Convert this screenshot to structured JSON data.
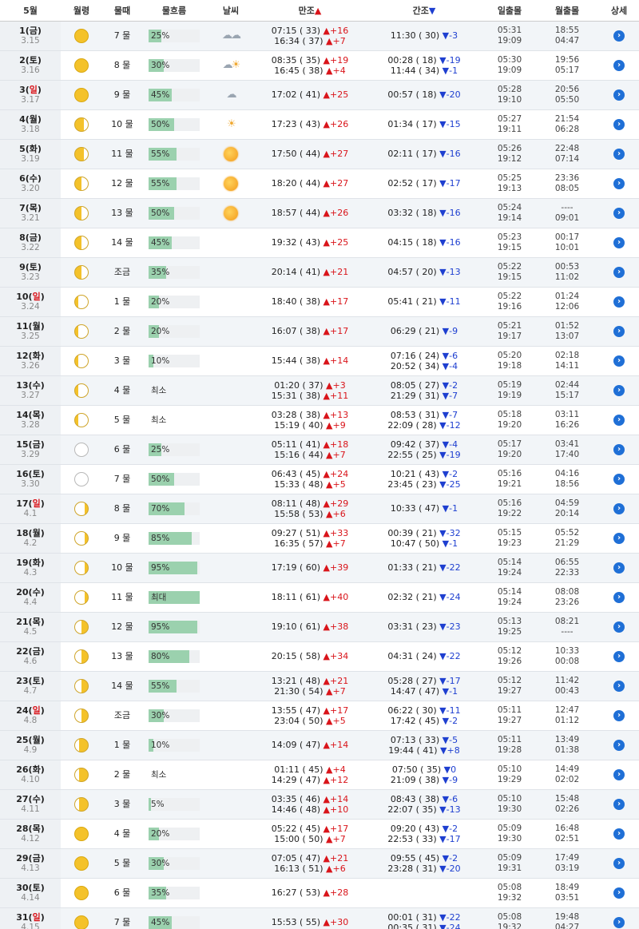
{
  "headers": {
    "date": "5월",
    "moon": "월령",
    "tide_age": "물때",
    "flow": "물흐름",
    "weather": "날씨",
    "high": "만조",
    "low": "간조",
    "sun": "일출몰",
    "moonrise": "월출몰",
    "detail": "상세"
  },
  "symbols": {
    "up": "▲",
    "down": "▼",
    "detail": "›"
  },
  "rows": [
    {
      "day": "1(",
      "dow": "금",
      "end": ")",
      "lunar": "3.15",
      "moon": "full",
      "age": "7 물",
      "flow": "25%",
      "pct": 25,
      "weather": [
        "rain-cloud-icon",
        "rain-cloud-icon"
      ],
      "high": [
        [
          "07:15 ( 33)",
          "+16"
        ],
        [
          "16:34 ( 37)",
          "+7"
        ]
      ],
      "low": [
        [
          "11:30 ( 30)",
          "-3"
        ]
      ],
      "sun": [
        "05:31",
        "19:09"
      ],
      "mn": [
        "18:55",
        "04:47"
      ]
    },
    {
      "day": "2(",
      "dow": "토",
      "end": ")",
      "lunar": "3.16",
      "moon": "full",
      "age": "8 물",
      "flow": "30%",
      "pct": 30,
      "weather": [
        "cloud-icon",
        "sun-cloud-icon"
      ],
      "high": [
        [
          "08:35 ( 35)",
          "+19"
        ],
        [
          "16:45 ( 38)",
          "+4"
        ]
      ],
      "low": [
        [
          "00:28 ( 18)",
          "-19"
        ],
        [
          "11:44 ( 34)",
          "-1"
        ]
      ],
      "sun": [
        "05:30",
        "19:09"
      ],
      "mn": [
        "19:56",
        "05:17"
      ]
    },
    {
      "day": "3(",
      "dow": "일",
      "end": ")",
      "lunar": "3.17",
      "moon": "full",
      "age": "9 물",
      "flow": "45%",
      "pct": 45,
      "weather": [
        "rain-cloud-icon"
      ],
      "high": [
        [
          "17:02 ( 41)",
          "+25"
        ]
      ],
      "low": [
        [
          "00:57 ( 18)",
          "-20"
        ]
      ],
      "sun": [
        "05:28",
        "19:10"
      ],
      "mn": [
        "20:56",
        "05:50"
      ]
    },
    {
      "day": "4(",
      "dow": "월",
      "end": ")",
      "lunar": "3.18",
      "moon": "wane-r",
      "age": "10 물",
      "flow": "50%",
      "pct": 50,
      "weather": [
        "sun-cloud-icon"
      ],
      "high": [
        [
          "17:23 ( 43)",
          "+26"
        ]
      ],
      "low": [
        [
          "01:34 ( 17)",
          "-15"
        ]
      ],
      "sun": [
        "05:27",
        "19:11"
      ],
      "mn": [
        "21:54",
        "06:28"
      ]
    },
    {
      "day": "5(",
      "dow": "화",
      "end": ")",
      "lunar": "3.19",
      "moon": "wane-r",
      "age": "11 물",
      "flow": "55%",
      "pct": 55,
      "weather": [
        "sun-icon"
      ],
      "high": [
        [
          "17:50 ( 44)",
          "+27"
        ]
      ],
      "low": [
        [
          "02:11 ( 17)",
          "-16"
        ]
      ],
      "sun": [
        "05:26",
        "19:12"
      ],
      "mn": [
        "22:48",
        "07:14"
      ]
    },
    {
      "day": "6(",
      "dow": "수",
      "end": ")",
      "lunar": "3.20",
      "moon": "wane-h",
      "age": "12 물",
      "flow": "55%",
      "pct": 55,
      "weather": [
        "sun-icon"
      ],
      "high": [
        [
          "18:20 ( 44)",
          "+27"
        ]
      ],
      "low": [
        [
          "02:52 ( 17)",
          "-17"
        ]
      ],
      "sun": [
        "05:25",
        "19:13"
      ],
      "mn": [
        "23:36",
        "08:05"
      ]
    },
    {
      "day": "7(",
      "dow": "목",
      "end": ")",
      "lunar": "3.21",
      "moon": "wane-h",
      "age": "13 물",
      "flow": "50%",
      "pct": 50,
      "weather": [
        "sun-icon"
      ],
      "high": [
        [
          "18:57 ( 44)",
          "+26"
        ]
      ],
      "low": [
        [
          "03:32 ( 18)",
          "-16"
        ]
      ],
      "sun": [
        "05:24",
        "19:14"
      ],
      "mn": [
        "----",
        "09:01"
      ]
    },
    {
      "day": "8(",
      "dow": "금",
      "end": ")",
      "lunar": "3.22",
      "moon": "wane-h",
      "age": "14 물",
      "flow": "45%",
      "pct": 45,
      "weather": [],
      "high": [
        [
          "19:32 ( 43)",
          "+25"
        ]
      ],
      "low": [
        [
          "04:15 ( 18)",
          "-16"
        ]
      ],
      "sun": [
        "05:23",
        "19:15"
      ],
      "mn": [
        "00:17",
        "10:01"
      ]
    },
    {
      "day": "9(",
      "dow": "토",
      "end": ")",
      "lunar": "3.23",
      "moon": "wane-h",
      "age": "조금",
      "flow": "35%",
      "pct": 35,
      "weather": [],
      "high": [
        [
          "20:14 ( 41)",
          "+21"
        ]
      ],
      "low": [
        [
          "04:57 ( 20)",
          "-13"
        ]
      ],
      "sun": [
        "05:22",
        "19:15"
      ],
      "mn": [
        "00:53",
        "11:02"
      ]
    },
    {
      "day": "10(",
      "dow": "일",
      "end": ")",
      "lunar": "3.24",
      "moon": "wane-c",
      "age": "1 물",
      "flow": "20%",
      "pct": 20,
      "weather": [],
      "high": [
        [
          "18:40 ( 38)",
          "+17"
        ]
      ],
      "low": [
        [
          "05:41 ( 21)",
          "-11"
        ]
      ],
      "sun": [
        "05:22",
        "19:16"
      ],
      "mn": [
        "01:24",
        "12:06"
      ]
    },
    {
      "day": "11(",
      "dow": "월",
      "end": ")",
      "lunar": "3.25",
      "moon": "wane-c",
      "age": "2 물",
      "flow": "20%",
      "pct": 20,
      "weather": [],
      "high": [
        [
          "16:07 ( 38)",
          "+17"
        ]
      ],
      "low": [
        [
          "06:29 ( 21)",
          "-9"
        ]
      ],
      "sun": [
        "05:21",
        "19:17"
      ],
      "mn": [
        "01:52",
        "13:07"
      ]
    },
    {
      "day": "12(",
      "dow": "화",
      "end": ")",
      "lunar": "3.26",
      "moon": "wane-c",
      "age": "3 물",
      "flow": "10%",
      "pct": 10,
      "weather": [],
      "high": [
        [
          "15:44 ( 38)",
          "+14"
        ]
      ],
      "low": [
        [
          "07:16 ( 24)",
          "-6"
        ],
        [
          "20:52 ( 34)",
          "-4"
        ]
      ],
      "sun": [
        "05:20",
        "19:18"
      ],
      "mn": [
        "02:18",
        "14:11"
      ]
    },
    {
      "day": "13(",
      "dow": "수",
      "end": ")",
      "lunar": "3.27",
      "moon": "wane-c",
      "age": "4 물",
      "flow": "최소",
      "pct": 0,
      "weather": [],
      "high": [
        [
          "01:20 ( 37)",
          "+3"
        ],
        [
          "15:31 ( 38)",
          "+11"
        ]
      ],
      "low": [
        [
          "08:05 ( 27)",
          "-2"
        ],
        [
          "21:29 ( 31)",
          "-7"
        ]
      ],
      "sun": [
        "05:19",
        "19:19"
      ],
      "mn": [
        "02:44",
        "15:17"
      ]
    },
    {
      "day": "14(",
      "dow": "목",
      "end": ")",
      "lunar": "3.28",
      "moon": "wane-c",
      "age": "5 물",
      "flow": "최소",
      "pct": 0,
      "weather": [],
      "high": [
        [
          "03:28 ( 38)",
          "+13"
        ],
        [
          "15:19 ( 40)",
          "+9"
        ]
      ],
      "low": [
        [
          "08:53 ( 31)",
          "-7"
        ],
        [
          "22:09 ( 28)",
          "-12"
        ]
      ],
      "sun": [
        "05:18",
        "19:20"
      ],
      "mn": [
        "03:11",
        "16:26"
      ]
    },
    {
      "day": "15(",
      "dow": "금",
      "end": ")",
      "lunar": "3.29",
      "moon": "new",
      "age": "6 물",
      "flow": "25%",
      "pct": 25,
      "weather": [],
      "high": [
        [
          "05:11 ( 41)",
          "+18"
        ],
        [
          "15:16 ( 44)",
          "+7"
        ]
      ],
      "low": [
        [
          "09:42 ( 37)",
          "-4"
        ],
        [
          "22:55 ( 25)",
          "-19"
        ]
      ],
      "sun": [
        "05:17",
        "19:20"
      ],
      "mn": [
        "03:41",
        "17:40"
      ]
    },
    {
      "day": "16(",
      "dow": "토",
      "end": ")",
      "lunar": "3.30",
      "moon": "new",
      "age": "7 물",
      "flow": "50%",
      "pct": 50,
      "weather": [],
      "high": [
        [
          "06:43 ( 45)",
          "+24"
        ],
        [
          "15:33 ( 48)",
          "+5"
        ]
      ],
      "low": [
        [
          "10:21 ( 43)",
          "-2"
        ],
        [
          "23:45 ( 23)",
          "-25"
        ]
      ],
      "sun": [
        "05:16",
        "19:21"
      ],
      "mn": [
        "04:16",
        "18:56"
      ]
    },
    {
      "day": "17(",
      "dow": "일",
      "end": ")",
      "lunar": "4.1",
      "moon": "wax-c",
      "age": "8 물",
      "flow": "70%",
      "pct": 70,
      "weather": [],
      "high": [
        [
          "08:11 ( 48)",
          "+29"
        ],
        [
          "15:58 ( 53)",
          "+6"
        ]
      ],
      "low": [
        [
          "10:33 ( 47)",
          "-1"
        ]
      ],
      "sun": [
        "05:16",
        "19:22"
      ],
      "mn": [
        "04:59",
        "20:14"
      ]
    },
    {
      "day": "18(",
      "dow": "월",
      "end": ")",
      "lunar": "4.2",
      "moon": "wax-c",
      "age": "9 물",
      "flow": "85%",
      "pct": 85,
      "weather": [],
      "high": [
        [
          "09:27 ( 51)",
          "+33"
        ],
        [
          "16:35 ( 57)",
          "+7"
        ]
      ],
      "low": [
        [
          "00:39 ( 21)",
          "-32"
        ],
        [
          "10:47 ( 50)",
          "-1"
        ]
      ],
      "sun": [
        "05:15",
        "19:23"
      ],
      "mn": [
        "05:52",
        "21:29"
      ]
    },
    {
      "day": "19(",
      "dow": "화",
      "end": ")",
      "lunar": "4.3",
      "moon": "wax-c",
      "age": "10 물",
      "flow": "95%",
      "pct": 95,
      "weather": [],
      "high": [
        [
          "17:19 ( 60)",
          "+39"
        ]
      ],
      "low": [
        [
          "01:33 ( 21)",
          "-22"
        ]
      ],
      "sun": [
        "05:14",
        "19:24"
      ],
      "mn": [
        "06:55",
        "22:33"
      ]
    },
    {
      "day": "20(",
      "dow": "수",
      "end": ")",
      "lunar": "4.4",
      "moon": "wax-c",
      "age": "11 물",
      "flow": "최대",
      "pct": 100,
      "weather": [],
      "high": [
        [
          "18:11 ( 61)",
          "+40"
        ]
      ],
      "low": [
        [
          "02:32 ( 21)",
          "-24"
        ]
      ],
      "sun": [
        "05:14",
        "19:24"
      ],
      "mn": [
        "08:08",
        "23:26"
      ]
    },
    {
      "day": "21(",
      "dow": "목",
      "end": ")",
      "lunar": "4.5",
      "moon": "wax-h",
      "age": "12 물",
      "flow": "95%",
      "pct": 95,
      "weather": [],
      "high": [
        [
          "19:10 ( 61)",
          "+38"
        ]
      ],
      "low": [
        [
          "03:31 ( 23)",
          "-23"
        ]
      ],
      "sun": [
        "05:13",
        "19:25"
      ],
      "mn": [
        "08:21",
        "----"
      ]
    },
    {
      "day": "22(",
      "dow": "금",
      "end": ")",
      "lunar": "4.6",
      "moon": "wax-h",
      "age": "13 물",
      "flow": "80%",
      "pct": 80,
      "weather": [],
      "high": [
        [
          "20:15 ( 58)",
          "+34"
        ]
      ],
      "low": [
        [
          "04:31 ( 24)",
          "-22"
        ]
      ],
      "sun": [
        "05:12",
        "19:26"
      ],
      "mn": [
        "10:33",
        "00:08"
      ]
    },
    {
      "day": "23(",
      "dow": "토",
      "end": ")",
      "lunar": "4.7",
      "moon": "wax-h",
      "age": "14 물",
      "flow": "55%",
      "pct": 55,
      "weather": [],
      "high": [
        [
          "13:21 ( 48)",
          "+21"
        ],
        [
          "21:30 ( 54)",
          "+7"
        ]
      ],
      "low": [
        [
          "05:28 ( 27)",
          "-17"
        ],
        [
          "14:47 ( 47)",
          "-1"
        ]
      ],
      "sun": [
        "05:12",
        "19:27"
      ],
      "mn": [
        "11:42",
        "00:43"
      ]
    },
    {
      "day": "24(",
      "dow": "일",
      "end": ")",
      "lunar": "4.8",
      "moon": "wax-h",
      "age": "조금",
      "flow": "30%",
      "pct": 30,
      "weather": [],
      "high": [
        [
          "13:55 ( 47)",
          "+17"
        ],
        [
          "23:04 ( 50)",
          "+5"
        ]
      ],
      "low": [
        [
          "06:22 ( 30)",
          "-11"
        ],
        [
          "17:42 ( 45)",
          "-2"
        ]
      ],
      "sun": [
        "05:11",
        "19:27"
      ],
      "mn": [
        "12:47",
        "01:12"
      ]
    },
    {
      "day": "25(",
      "dow": "월",
      "end": ")",
      "lunar": "4.9",
      "moon": "wax-g",
      "age": "1 물",
      "flow": "10%",
      "pct": 10,
      "weather": [],
      "high": [
        [
          "14:09 ( 47)",
          "+14"
        ]
      ],
      "low": [
        [
          "07:13 ( 33)",
          "-5"
        ],
        [
          "19:44 ( 41)",
          "+8"
        ]
      ],
      "sun": [
        "05:11",
        "19:28"
      ],
      "mn": [
        "13:49",
        "01:38"
      ]
    },
    {
      "day": "26(",
      "dow": "화",
      "end": ")",
      "lunar": "4.10",
      "moon": "wax-g",
      "age": "2 물",
      "flow": "최소",
      "pct": 0,
      "weather": [],
      "high": [
        [
          "01:11 ( 45)",
          "+4"
        ],
        [
          "14:29 ( 47)",
          "+12"
        ]
      ],
      "low": [
        [
          "07:50 ( 35)",
          "0"
        ],
        [
          "21:09 ( 38)",
          "-9"
        ]
      ],
      "sun": [
        "05:10",
        "19:29"
      ],
      "mn": [
        "14:49",
        "02:02"
      ]
    },
    {
      "day": "27(",
      "dow": "수",
      "end": ")",
      "lunar": "4.11",
      "moon": "wax-g",
      "age": "3 물",
      "flow": "5%",
      "pct": 5,
      "weather": [],
      "high": [
        [
          "03:35 ( 46)",
          "+14"
        ],
        [
          "14:46 ( 48)",
          "+10"
        ]
      ],
      "low": [
        [
          "08:43 ( 38)",
          "-6"
        ],
        [
          "22:07 ( 35)",
          "-13"
        ]
      ],
      "sun": [
        "05:10",
        "19:30"
      ],
      "mn": [
        "15:48",
        "02:26"
      ]
    },
    {
      "day": "28(",
      "dow": "목",
      "end": ")",
      "lunar": "4.12",
      "moon": "full",
      "age": "4 물",
      "flow": "20%",
      "pct": 20,
      "weather": [],
      "high": [
        [
          "05:22 ( 45)",
          "+17"
        ],
        [
          "15:00 ( 50)",
          "+7"
        ]
      ],
      "low": [
        [
          "09:20 ( 43)",
          "-2"
        ],
        [
          "22:53 ( 33)",
          "-17"
        ]
      ],
      "sun": [
        "05:09",
        "19:30"
      ],
      "mn": [
        "16:48",
        "02:51"
      ]
    },
    {
      "day": "29(",
      "dow": "금",
      "end": ")",
      "lunar": "4.13",
      "moon": "full",
      "age": "5 물",
      "flow": "30%",
      "pct": 30,
      "weather": [],
      "high": [
        [
          "07:05 ( 47)",
          "+21"
        ],
        [
          "16:13 ( 51)",
          "+6"
        ]
      ],
      "low": [
        [
          "09:55 ( 45)",
          "-2"
        ],
        [
          "23:28 ( 31)",
          "-20"
        ]
      ],
      "sun": [
        "05:09",
        "19:31"
      ],
      "mn": [
        "17:49",
        "03:19"
      ]
    },
    {
      "day": "30(",
      "dow": "토",
      "end": ")",
      "lunar": "4.14",
      "moon": "full",
      "age": "6 물",
      "flow": "35%",
      "pct": 35,
      "weather": [],
      "high": [
        [
          "16:27 ( 53)",
          "+28"
        ]
      ],
      "low": [],
      "sun": [
        "05:08",
        "19:32"
      ],
      "mn": [
        "18:49",
        "03:51"
      ]
    },
    {
      "day": "31(",
      "dow": "일",
      "end": ")",
      "lunar": "4.15",
      "moon": "full",
      "age": "7 물",
      "flow": "45%",
      "pct": 45,
      "weather": [],
      "high": [
        [
          "15:53 ( 55)",
          "+30"
        ]
      ],
      "low": [
        [
          "00:01 ( 31)",
          "-22"
        ],
        [
          "00:35 ( 31)",
          "-24"
        ]
      ],
      "sun": [
        "05:08",
        "19:32"
      ],
      "mn": [
        "19:48",
        "04:27"
      ]
    }
  ]
}
